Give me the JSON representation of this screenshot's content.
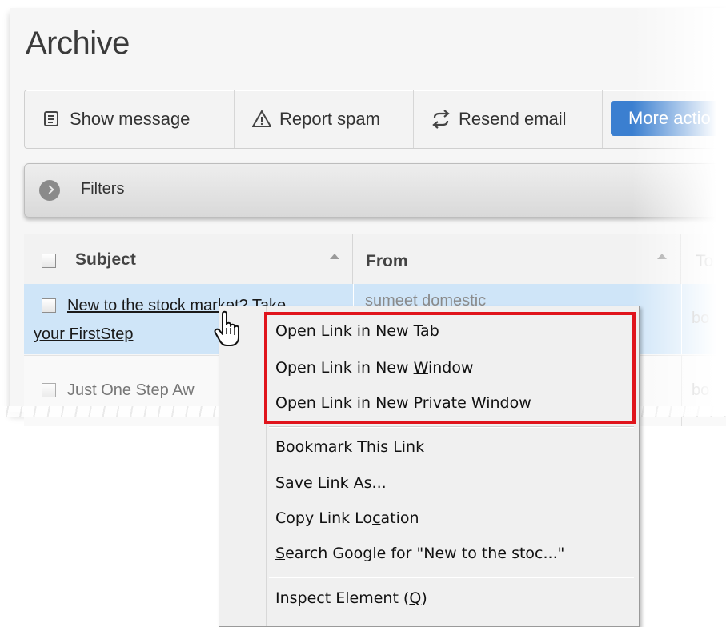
{
  "page": {
    "title": "Archive"
  },
  "toolbar": {
    "show_message": "Show message",
    "report_spam": "Report spam",
    "resend_email": "Resend email",
    "more_actions": "More actio"
  },
  "filters": {
    "label": "Filters"
  },
  "table": {
    "headers": {
      "subject": "Subject",
      "from": "From",
      "to": "To"
    },
    "rows": [
      {
        "subject_line1": "New to the stock market? Take",
        "subject_line2": "your FirstStep",
        "from": "sumeet domestic",
        "to": "bo"
      },
      {
        "subject": "Just One Step Aw",
        "to": "bo"
      }
    ]
  },
  "context_menu": {
    "items": [
      {
        "pre": "Open Link in New ",
        "key": "T",
        "post": "ab"
      },
      {
        "pre": "Open Link in New ",
        "key": "W",
        "post": "indow"
      },
      {
        "pre": "Open Link in New ",
        "key": "P",
        "post": "rivate Window"
      },
      {
        "pre": "Bookmark This ",
        "key": "L",
        "post": "ink"
      },
      {
        "pre": "Save Lin",
        "key": "k",
        "post": " As..."
      },
      {
        "pre": "Copy Link Lo",
        "key": "c",
        "post": "ation"
      },
      {
        "pre": "",
        "key": "S",
        "post": "earch Google for \"New to the stoc...\""
      },
      {
        "pre": "Inspect Element (",
        "key": "Q",
        "post": ")"
      }
    ]
  },
  "colors": {
    "accent": "#3b7fd0",
    "selected_row": "#cfe5f8",
    "highlight_box": "#e0141c"
  }
}
